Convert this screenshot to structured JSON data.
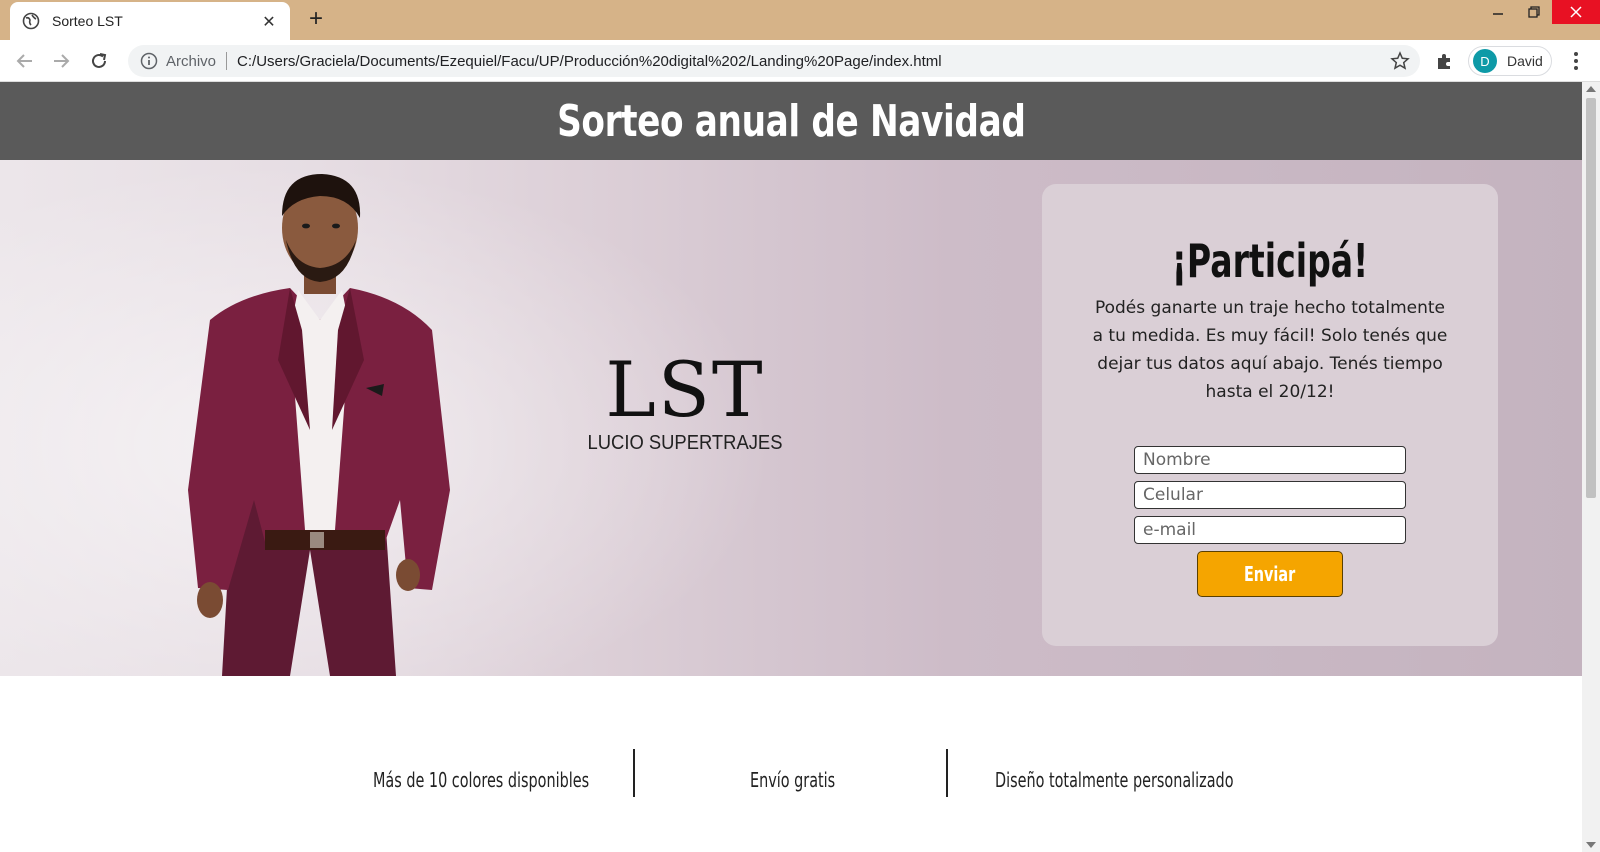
{
  "browser": {
    "tab_title": "Sorteo LST",
    "new_tab_symbol": "+",
    "close_tab_symbol": "✕",
    "origin_label": "Archivo",
    "url": "C:/Users/Graciela/Documents/Ezequiel/Facu/UP/Producción%20digital%202/Landing%20Page/index.html",
    "profile_initial": "D",
    "profile_name": "David",
    "accent_color": "#d6b388"
  },
  "page": {
    "title": "Sorteo anual de Navidad",
    "logo": {
      "mark": "LST",
      "subtitle": "LUCIO SUPERTRAJES"
    },
    "form": {
      "title": "¡Participá!",
      "description": "Podés ganarte un traje hecho totalmente a tu medida. Es muy fácil! Solo tenés que dejar tus datos aquí abajo. Tenés tiempo hasta el 20/12!",
      "name_placeholder": "Nombre",
      "phone_placeholder": "Celular",
      "email_placeholder": "e-mail",
      "submit_label": "Enviar",
      "submit_color": "#f5a500"
    },
    "features": [
      "Más de 10 colores disponibles",
      "Envío gratis",
      "Diseño totalmente personalizado"
    ]
  }
}
